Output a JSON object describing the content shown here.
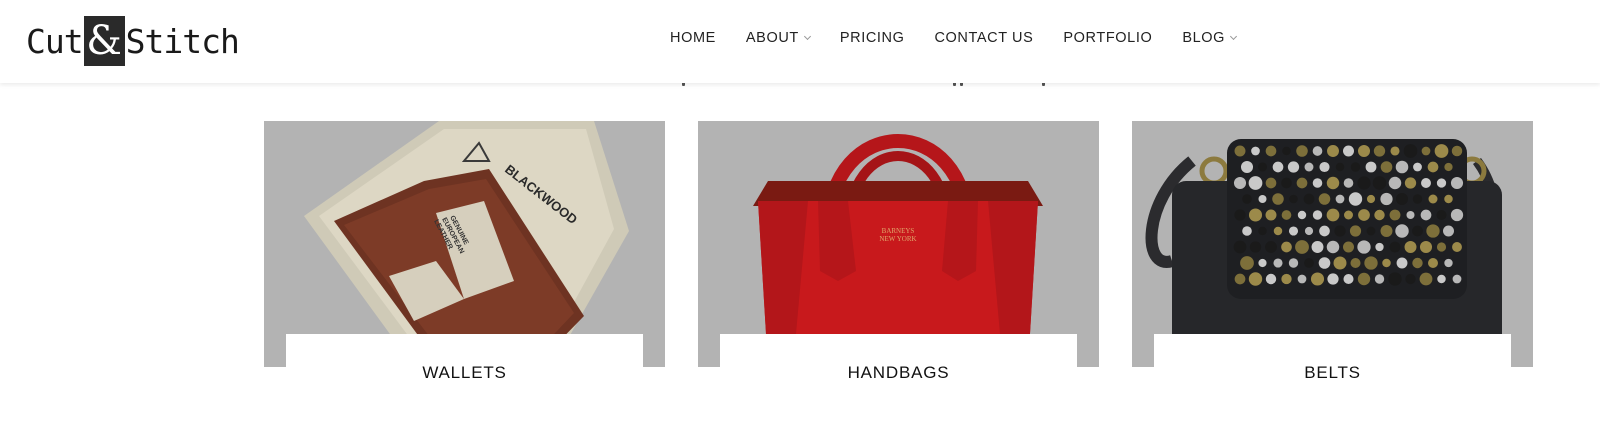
{
  "logo": {
    "word_left": "Cut",
    "ampersand": "&",
    "word_right": "Stitch"
  },
  "nav": {
    "items": [
      {
        "label": "HOME",
        "dropdown": false
      },
      {
        "label": "ABOUT",
        "dropdown": true
      },
      {
        "label": "PRICING",
        "dropdown": false
      },
      {
        "label": "CONTACT US",
        "dropdown": false
      },
      {
        "label": "PORTFOLIO",
        "dropdown": false
      },
      {
        "label": "BLOG",
        "dropdown": true
      }
    ]
  },
  "categories": [
    {
      "label": "WALLETS",
      "box_brand": "BLACKWOOD",
      "band_text": [
        "GENUINE",
        "EUROPEAN",
        "LEATHER"
      ]
    },
    {
      "label": "HANDBAGS",
      "bag_brand": [
        "BARNEYS",
        "NEW YORK"
      ]
    },
    {
      "label": "BELTS"
    }
  ],
  "colors": {
    "overlay_gray": "#b3b3b3",
    "red": "#c8191c",
    "leather_brown": "#7a3a26",
    "header_bg": "#ffffff"
  }
}
